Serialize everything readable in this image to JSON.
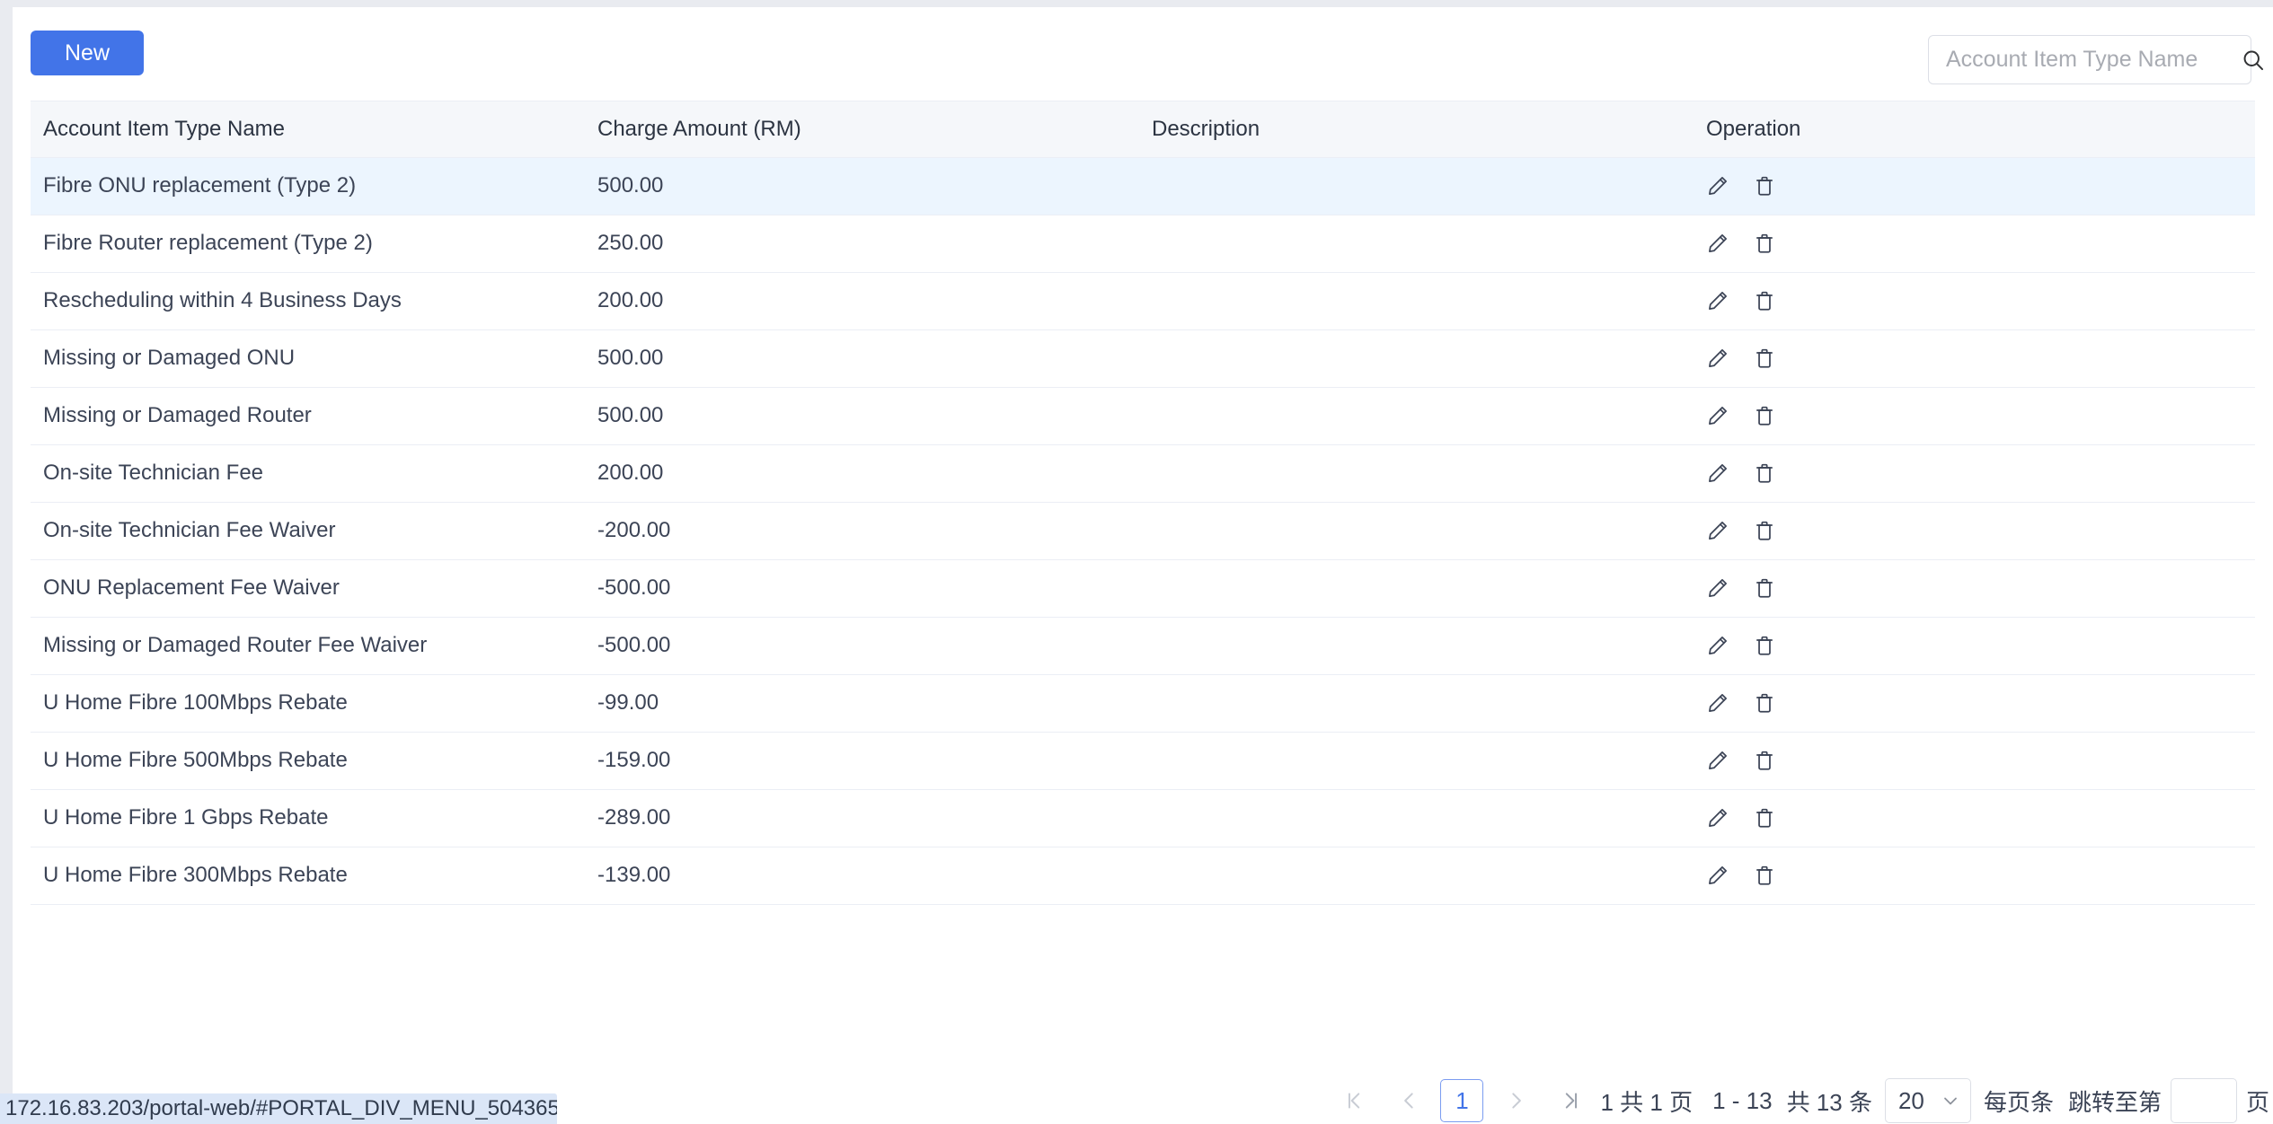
{
  "toolbar": {
    "new_label": "New",
    "search_placeholder": "Account Item Type Name",
    "search_value": "",
    "search_icon": "search-icon"
  },
  "table": {
    "columns": [
      {
        "key": "name",
        "label": "Account Item Type Name"
      },
      {
        "key": "amount",
        "label": "Charge Amount (RM)"
      },
      {
        "key": "description",
        "label": "Description"
      },
      {
        "key": "operation",
        "label": "Operation"
      }
    ],
    "row_actions": [
      {
        "name": "edit-icon",
        "title": "Edit"
      },
      {
        "name": "delete-icon",
        "title": "Delete"
      }
    ],
    "highlighted_row_index": 0,
    "rows": [
      {
        "name": "Fibre ONU replacement (Type 2)",
        "amount": "500.00",
        "description": ""
      },
      {
        "name": "Fibre Router replacement (Type 2)",
        "amount": "250.00",
        "description": ""
      },
      {
        "name": "Rescheduling within 4 Business Days",
        "amount": "200.00",
        "description": ""
      },
      {
        "name": "Missing or Damaged ONU",
        "amount": "500.00",
        "description": ""
      },
      {
        "name": "Missing or Damaged Router",
        "amount": "500.00",
        "description": ""
      },
      {
        "name": "On-site Technician Fee",
        "amount": "200.00",
        "description": ""
      },
      {
        "name": "On-site Technician Fee Waiver",
        "amount": "-200.00",
        "description": ""
      },
      {
        "name": "ONU Replacement Fee Waiver",
        "amount": "-500.00",
        "description": ""
      },
      {
        "name": "Missing or Damaged Router Fee Waiver",
        "amount": "-500.00",
        "description": ""
      },
      {
        "name": "U Home Fibre 100Mbps Rebate",
        "amount": "-99.00",
        "description": ""
      },
      {
        "name": "U Home Fibre 500Mbps Rebate",
        "amount": "-159.00",
        "description": ""
      },
      {
        "name": "U Home Fibre 1 Gbps Rebate",
        "amount": "-289.00",
        "description": ""
      },
      {
        "name": "U Home Fibre 300Mbps Rebate",
        "amount": "-139.00",
        "description": ""
      }
    ]
  },
  "pagination": {
    "first_icon": "first-page-icon",
    "prev_icon": "previous-page-icon",
    "next_icon": "next-page-icon",
    "last_icon": "last-page-icon",
    "current_page": "1",
    "page_summary": "1 共 1 页",
    "range_summary": "1 - 13",
    "total_summary": "共 13 条",
    "page_size": "20",
    "page_size_suffix": "每页条",
    "jump_prefix": "跳转至第",
    "jump_value": "",
    "jump_suffix": "页"
  },
  "status_bar": {
    "url": "172.16.83.203/portal-web/#PORTAL_DIV_MENU_504365"
  },
  "colors": {
    "primary": "#4274e8",
    "header_bg": "#f5f7fa",
    "row_highlight": "#ecf5fe",
    "border": "#ebeef5",
    "page_bg": "#e9ebf0",
    "status_bg": "#dbe6f7"
  }
}
